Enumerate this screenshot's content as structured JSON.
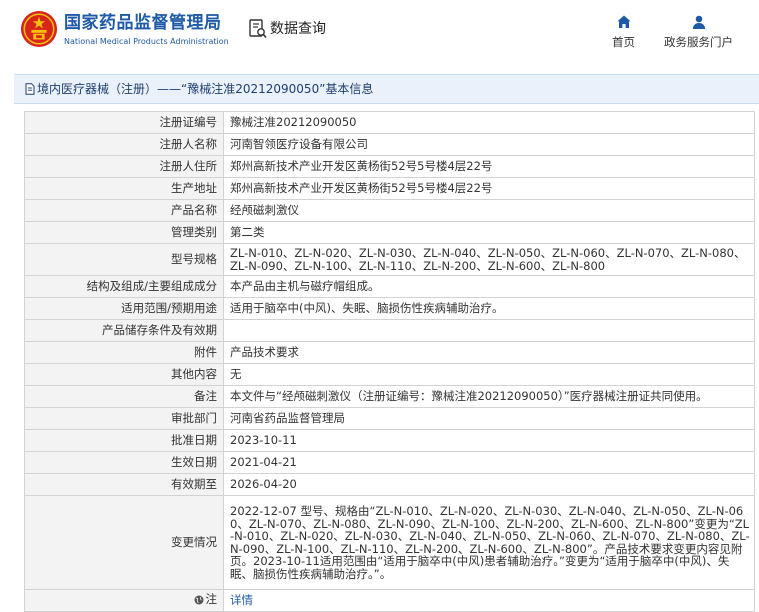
{
  "header": {
    "brand_cn": "国家药品监督管理局",
    "brand_en": "National Medical Products Administration",
    "query_label": "数据查询",
    "nav_home": "首页",
    "nav_service": "政务服务门户"
  },
  "titlebar": {
    "text": "境内医疗器械（注册）——“豫械注准20212090050”基本信息"
  },
  "rows": [
    {
      "key": "注册证编号",
      "value": "豫械注准20212090050"
    },
    {
      "key": "注册人名称",
      "value": "河南智领医疗设备有限公司"
    },
    {
      "key": "注册人住所",
      "value": "郑州高新技术产业开发区黄杨街52号5号楼4层22号"
    },
    {
      "key": "生产地址",
      "value": "郑州高新技术产业开发区黄杨街52号5号楼4层22号"
    },
    {
      "key": "产品名称",
      "value": "经颅磁刺激仪"
    },
    {
      "key": "管理类别",
      "value": "第二类"
    },
    {
      "key": "型号规格",
      "value": "ZL-N-010、ZL-N-020、ZL-N-030、ZL-N-040、ZL-N-050、ZL-N-060、ZL-N-070、ZL-N-080、ZL-N-090、ZL-N-100、ZL-N-110、ZL-N-200、ZL-N-600、ZL-N-800"
    },
    {
      "key": "结构及组成/主要组成成分",
      "value": "本产品由主机与磁疗帽组成。"
    },
    {
      "key": "适用范围/预期用途",
      "value": "适用于脑卒中(中风)、失眠、脑损伤性疾病辅助治疗。"
    },
    {
      "key": "产品储存条件及有效期",
      "value": ""
    },
    {
      "key": "附件",
      "value": "产品技术要求"
    },
    {
      "key": "其他内容",
      "value": "无"
    },
    {
      "key": "备注",
      "value": "本文件与“经颅磁刺激仪（注册证编号：豫械注准20212090050）”医疗器械注册证共同使用。"
    },
    {
      "key": "审批部门",
      "value": "河南省药品监督管理局"
    },
    {
      "key": "批准日期",
      "value": "2023-10-11"
    },
    {
      "key": "生效日期",
      "value": "2021-04-21"
    },
    {
      "key": "有效期至",
      "value": "2026-04-20"
    },
    {
      "key": "变更情况",
      "value": "2022-12-07 型号、规格由“ZL-N-010、ZL-N-020、ZL-N-030、ZL-N-040、ZL-N-050、ZL-N-060、ZL-N-070、ZL-N-080、ZL-N-090、ZL-N-100、ZL-N-200、ZL-N-600、ZL-N-800”变更为“ZL-N-010、ZL-N-020、ZL-N-030、ZL-N-040、ZL-N-050、ZL-N-060、ZL-N-070、ZL-N-080、ZL-N-090、ZL-N-100、ZL-N-110、ZL-N-200、ZL-N-600、ZL-N-800”。产品技术要求变更内容见附页。2023-10-11适用范围由“适用于脑卒中(中风)患者辅助治疗。”变更为“适用于脑卒中(中风)、失眠、脑损伤性疾病辅助治疗。”。"
    },
    {
      "key": "注",
      "value": "详情"
    }
  ],
  "colors": {
    "brand_blue": "#1f5aa6",
    "emblem_red": "#d6251c",
    "emblem_gold": "#f4c20d",
    "titlebar_bg": "#eaf1fa",
    "key_cell_bg": "#f3f3f3",
    "border": "#d3d3d3"
  },
  "icons": {
    "logo": "national-emblem-icon",
    "query": "document-search-icon",
    "home": "home-icon",
    "service": "user-icon",
    "title": "document-icon",
    "note": "globe-icon"
  }
}
